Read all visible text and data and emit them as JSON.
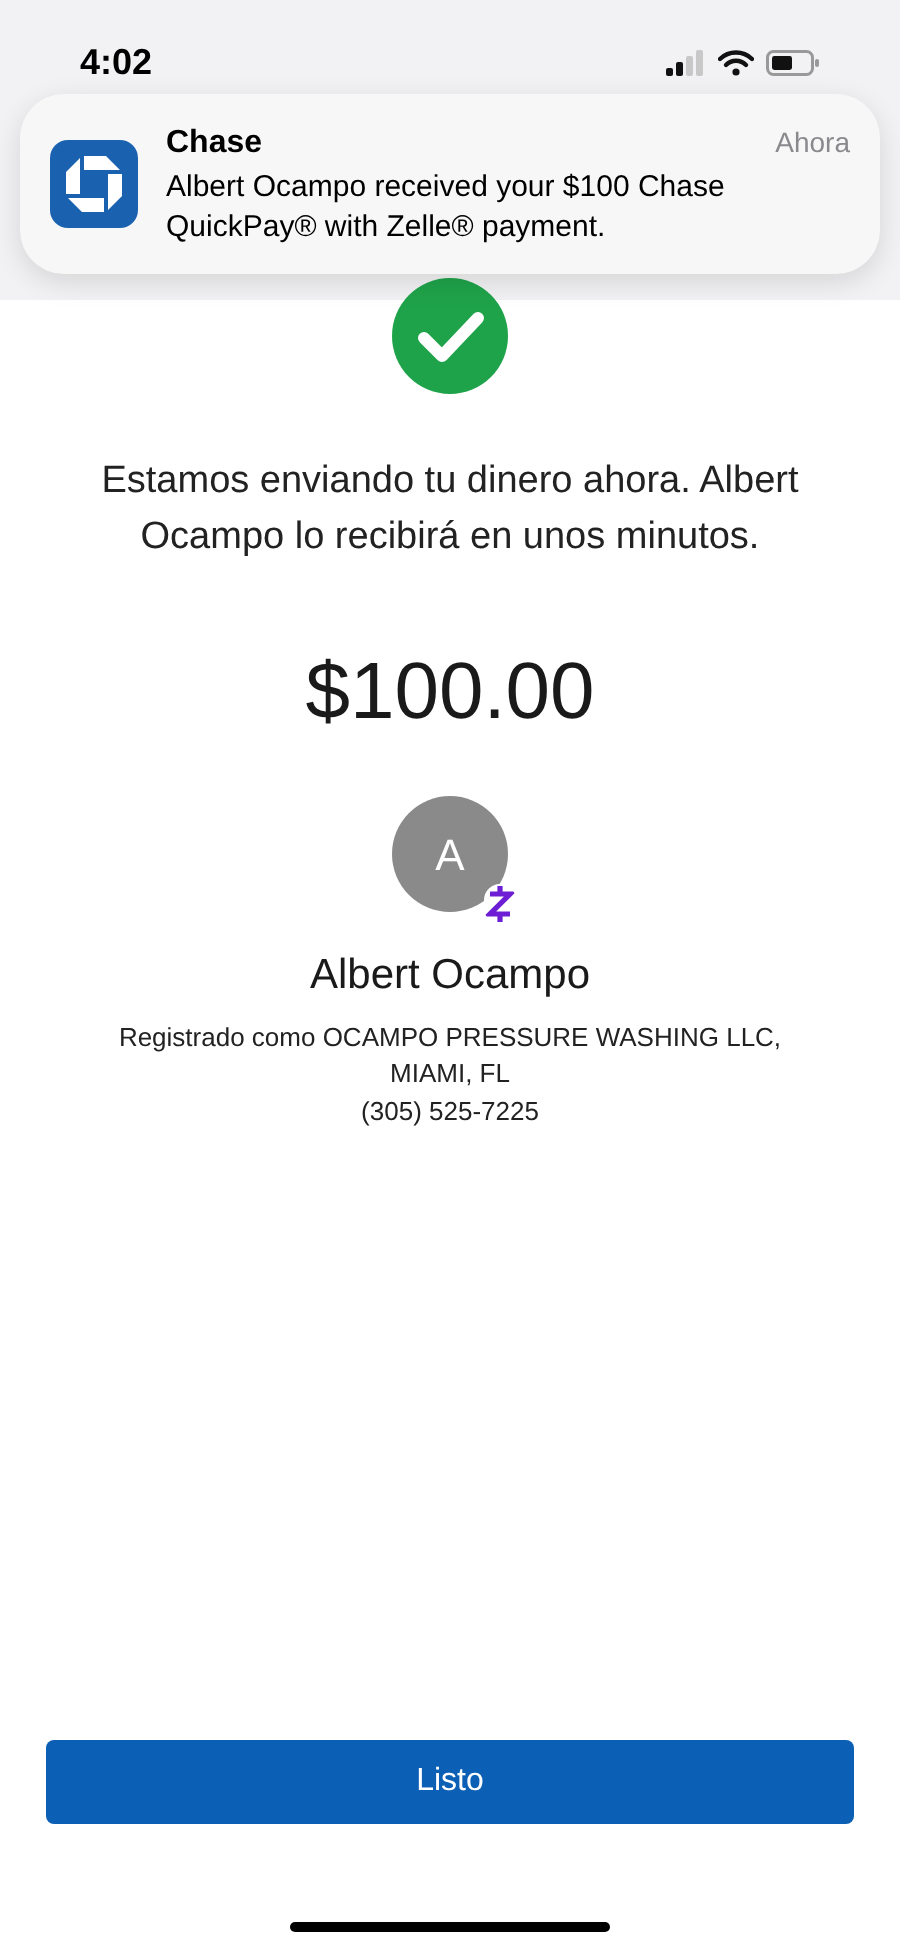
{
  "status_bar": {
    "time": "4:02"
  },
  "notification": {
    "app": "Chase",
    "time": "Ahora",
    "message": "Albert Ocampo received your $100 Chase QuickPay® with Zelle® payment."
  },
  "confirmation": {
    "message": "Estamos enviando tu dinero ahora. Albert Ocampo lo recibirá en unos minutos.",
    "amount": "$100.00"
  },
  "recipient": {
    "initial": "A",
    "name": "Albert Ocampo",
    "registered_as": "Registrado como OCAMPO PRESSURE WASHING LLC,",
    "location": "MIAMI, FL",
    "phone": "(305) 525-7225"
  },
  "button": "Listo"
}
